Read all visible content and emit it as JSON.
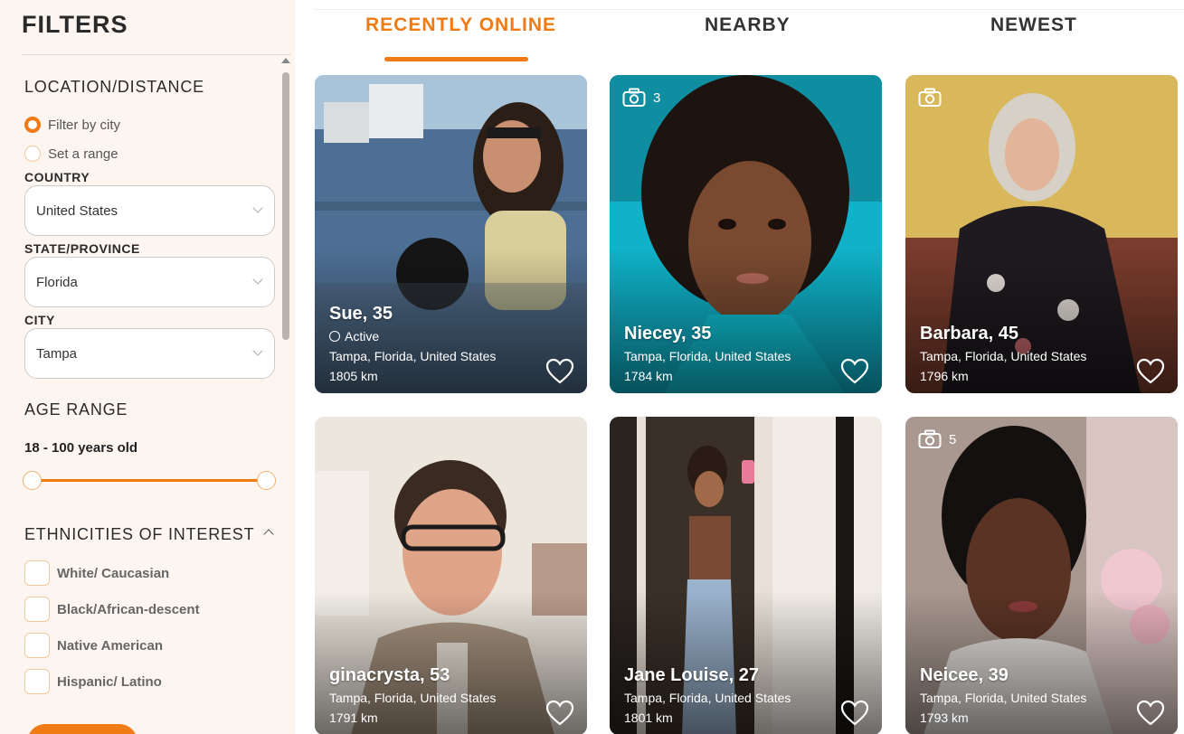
{
  "sidebar": {
    "title": "FILTERS",
    "location": {
      "section_title": "LOCATION/DISTANCE",
      "option_city": "Filter by city",
      "option_range": "Set a range",
      "country_label": "COUNTRY",
      "country_value": "United States",
      "state_label": "STATE/PROVINCE",
      "state_value": "Florida",
      "city_label": "CITY",
      "city_value": "Tampa"
    },
    "age": {
      "section_title": "AGE RANGE",
      "value": "18 - 100 years old",
      "min": 18,
      "max": 100
    },
    "ethnicities": {
      "section_title": "ETHNICITIES OF INTEREST",
      "options": [
        "White/ Caucasian",
        "Black/African-descent",
        "Native American",
        "Hispanic/ Latino"
      ]
    }
  },
  "tabs": {
    "recently_online": "RECENTLY ONLINE",
    "nearby": "NEARBY",
    "newest": "NEWEST",
    "active_tab": "RECENTLY ONLINE"
  },
  "colors": {
    "accent": "#f07a14",
    "sidebar_bg": "#fdf6f0"
  },
  "cards": [
    {
      "name": "Sue, 35",
      "status": "Active",
      "location": "Tampa, Florida, United States",
      "distance": "1805 km",
      "photos": ""
    },
    {
      "name": "Niecey, 35",
      "location": "Tampa, Florida, United States",
      "distance": "1784 km",
      "photos": "3"
    },
    {
      "name": "Barbara, 45",
      "location": "Tampa, Florida, United States",
      "distance": "1796 km",
      "photos": ""
    },
    {
      "name": "ginacrysta, 53",
      "location": "Tampa, Florida, United States",
      "distance": "1791 km",
      "photos": ""
    },
    {
      "name": "Jane Louise, 27",
      "location": "Tampa, Florida, United States",
      "distance": "1801 km",
      "photos": ""
    },
    {
      "name": "Neicee, 39",
      "location": "Tampa, Florida, United States",
      "distance": "1793 km",
      "photos": "5"
    }
  ],
  "icons": {
    "heart": "heart-icon",
    "camera": "camera-icon",
    "active": "active-status-icon"
  }
}
